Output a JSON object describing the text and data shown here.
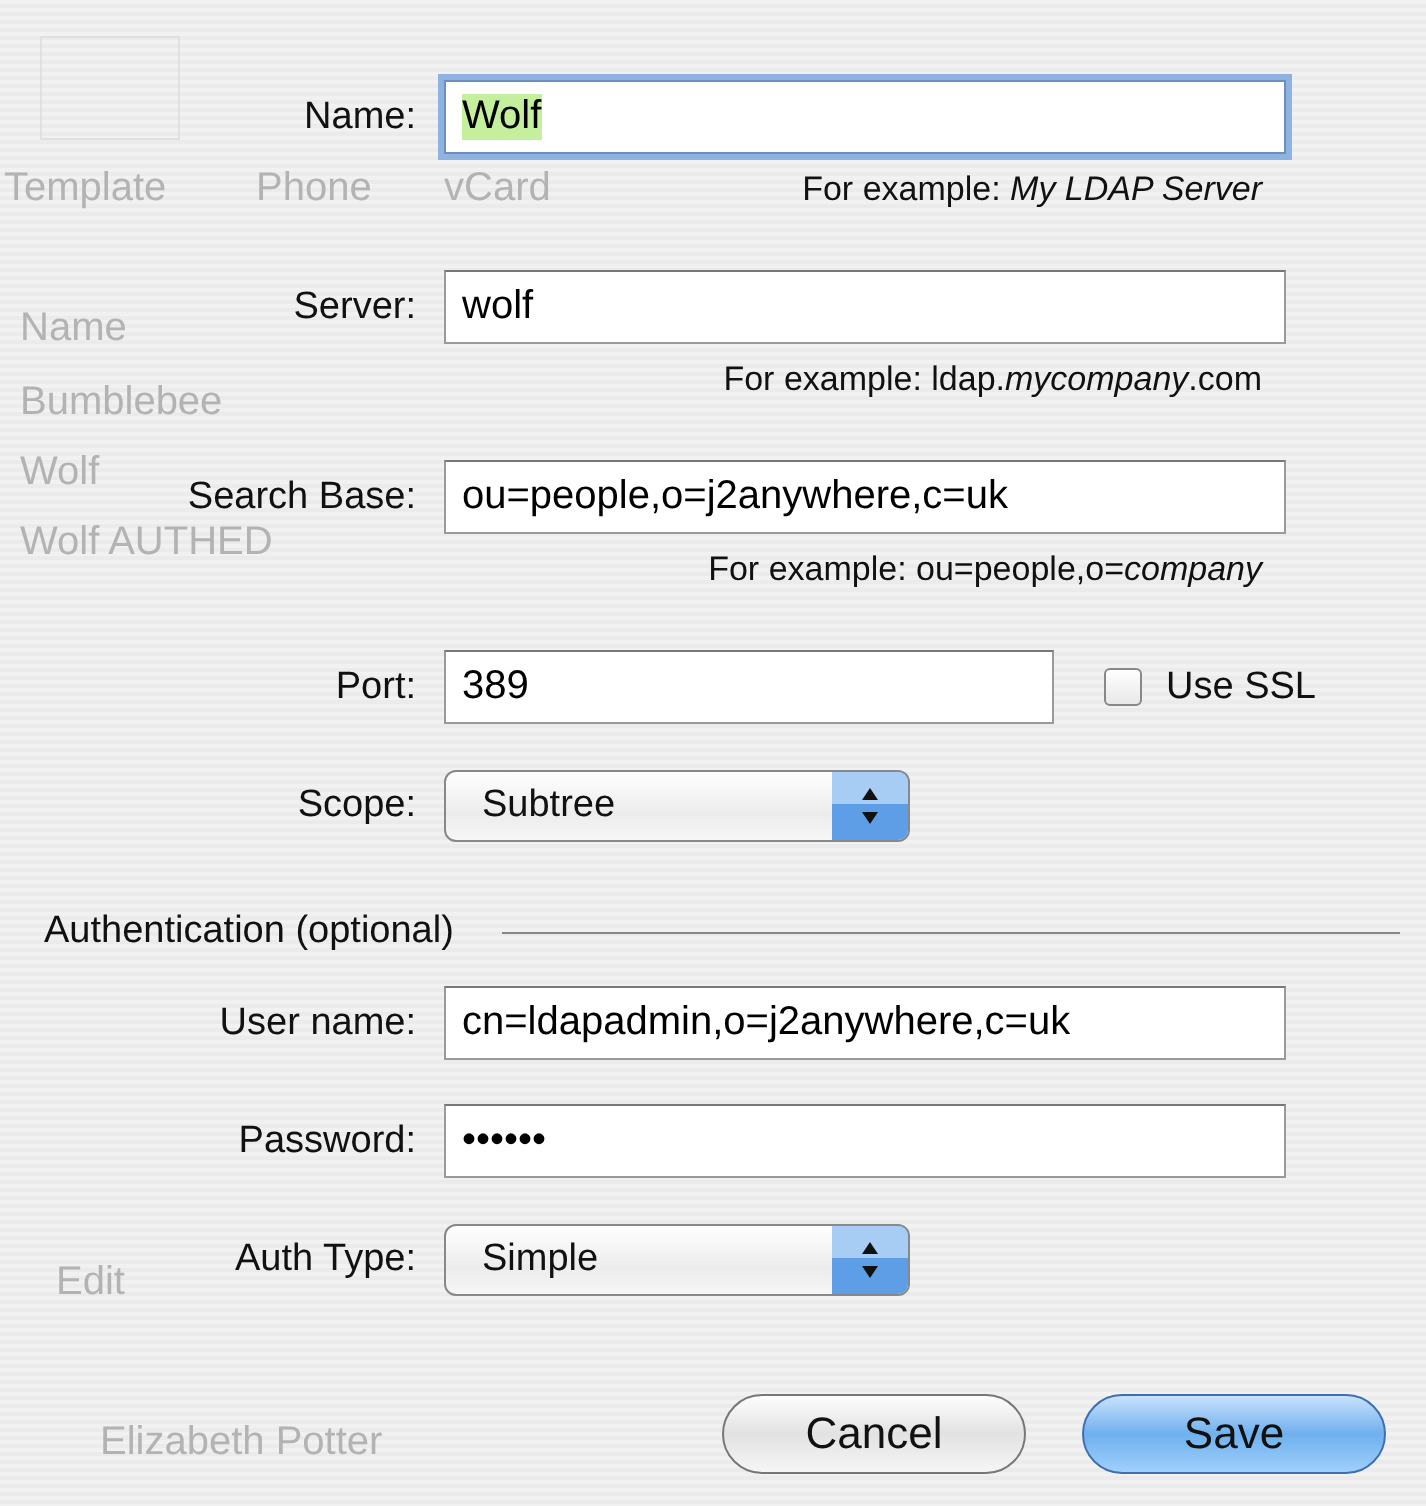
{
  "background": {
    "toolbar": [
      "Template",
      "Phone",
      "vCard"
    ],
    "list_header": "Name",
    "list_items": [
      "Bumblebee",
      "Wolf",
      "Wolf AUTHED"
    ],
    "bottom_button": "Edit",
    "bottom_item": "Elizabeth Potter"
  },
  "fields": [
    {
      "kind": "text",
      "label": "Name:",
      "value": "Wolf",
      "focused": true,
      "hint": "For example: *My LDAP Server*"
    },
    {
      "kind": "text",
      "label": "Server:",
      "value": "wolf",
      "focused": false,
      "hint": "For example:  ldap.*mycompany*.com"
    },
    {
      "kind": "text",
      "label": "Search Base:",
      "value": "ou=people,o=j2anywhere,c=uk",
      "focused": false,
      "hint": "For example: ou=people,o=*company*"
    },
    {
      "kind": "port",
      "label": "Port:",
      "value": "389",
      "focused": false,
      "checkbox": {
        "label": "Use SSL",
        "checked": false
      }
    },
    {
      "kind": "popup",
      "label": "Scope:",
      "value": "Subtree"
    },
    {
      "kind": "section",
      "label": "Authentication (optional)"
    },
    {
      "kind": "text",
      "label": "User name:",
      "value": "cn=ldapadmin,o=j2anywhere,c=uk",
      "focused": false
    },
    {
      "kind": "text",
      "label": "Password:",
      "value": "••••••",
      "focused": false
    },
    {
      "kind": "popup",
      "label": "Auth Type:",
      "value": "Simple"
    }
  ],
  "buttons": [
    {
      "label": "Cancel",
      "default": false
    },
    {
      "label": "Save",
      "default": true
    }
  ]
}
